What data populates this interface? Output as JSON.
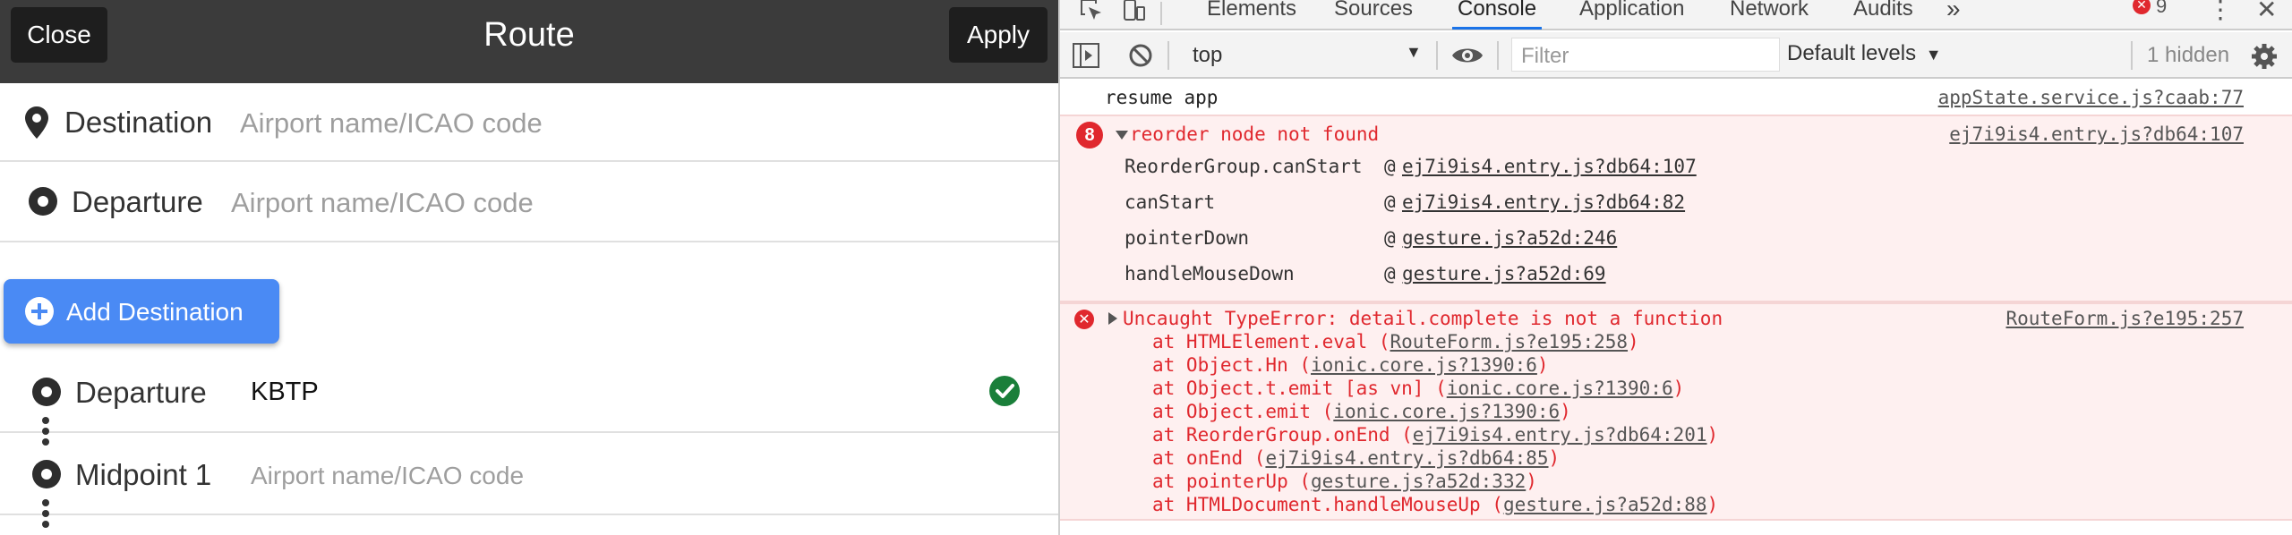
{
  "app": {
    "toolbar": {
      "close_label": "Close",
      "title": "Route",
      "apply_label": "Apply"
    },
    "rows": {
      "destination": {
        "label": "Destination",
        "placeholder": "Airport name/ICAO code"
      },
      "departure": {
        "label": "Departure",
        "placeholder": "Airport name/ICAO code"
      }
    },
    "add_destination_label": "Add Destination",
    "legs": {
      "departure": {
        "label": "Departure",
        "value": "KBTP"
      },
      "midpoint": {
        "label": "Midpoint 1",
        "placeholder": "Airport name/ICAO code"
      }
    },
    "colors": {
      "toolbar": "#3b3b3b",
      "accent": "#4a8af4",
      "success": "#1a7f3a"
    }
  },
  "devtools": {
    "tabs": [
      "Elements",
      "Sources",
      "Console",
      "Application",
      "Network",
      "Audits"
    ],
    "active_tab": "Console",
    "more_tabs": "»",
    "error_count": "9",
    "toolbar": {
      "context": "top",
      "filter_placeholder": "Filter",
      "levels": "Default levels",
      "hidden": "1 hidden"
    },
    "logs": {
      "resume": {
        "message": "resume app",
        "source": "appState.service.js?caab:77"
      },
      "reorder": {
        "count": "8",
        "message": "reorder node not found",
        "source": "ej7i9is4.entry.js?db64:107",
        "frames": [
          {
            "fn": "ReorderGroup.canStart",
            "at": "@",
            "loc": "ej7i9is4.entry.js?db64:107"
          },
          {
            "fn": "canStart",
            "at": "@",
            "loc": "ej7i9is4.entry.js?db64:82"
          },
          {
            "fn": "pointerDown",
            "at": "@",
            "loc": "gesture.js?a52d:246"
          },
          {
            "fn": "handleMouseDown",
            "at": "@",
            "loc": "gesture.js?a52d:69"
          }
        ]
      },
      "typeerror": {
        "message": "Uncaught TypeError: detail.complete is not a function",
        "source": "RouteForm.js?e195:257",
        "stack": [
          {
            "text": "at HTMLElement.eval (",
            "loc": "RouteForm.js?e195:258",
            "end": ")"
          },
          {
            "text": "at Object.Hn (",
            "loc": "ionic.core.js?1390:6",
            "end": ")"
          },
          {
            "text": "at Object.t.emit [as vn] (",
            "loc": "ionic.core.js?1390:6",
            "end": ")"
          },
          {
            "text": "at Object.emit (",
            "loc": "ionic.core.js?1390:6",
            "end": ")"
          },
          {
            "text": "at ReorderGroup.onEnd (",
            "loc": "ej7i9is4.entry.js?db64:201",
            "end": ")"
          },
          {
            "text": "at onEnd (",
            "loc": "ej7i9is4.entry.js?db64:85",
            "end": ")"
          },
          {
            "text": "at pointerUp (",
            "loc": "gesture.js?a52d:332",
            "end": ")"
          },
          {
            "text": "at HTMLDocument.handleMouseUp (",
            "loc": "gesture.js?a52d:88",
            "end": ")"
          }
        ]
      }
    },
    "colors": {
      "error": "#e0282e",
      "error_bg": "#fef0f0",
      "link": "#1a57c7",
      "tab_active": "#1a73e8"
    }
  }
}
